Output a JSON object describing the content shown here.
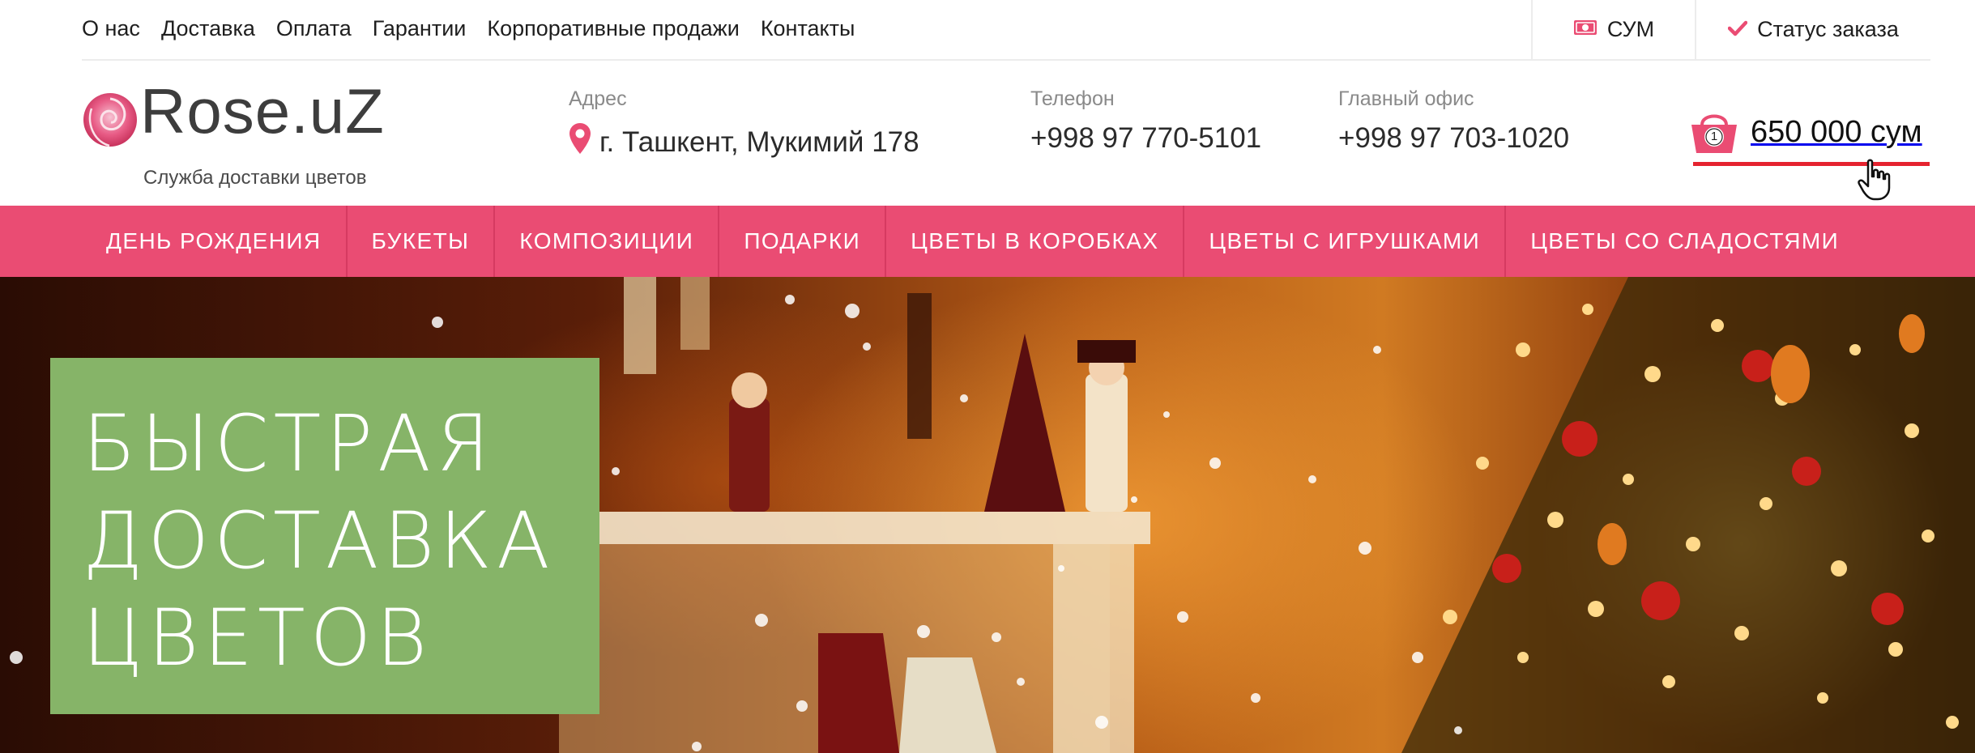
{
  "top_nav": {
    "links": [
      "О нас",
      "Доставка",
      "Оплата",
      "Гарантии",
      "Корпоративные продажи",
      "Контакты"
    ]
  },
  "currency": {
    "label": "СУМ",
    "icon": "money-icon"
  },
  "order_status": {
    "label": "Статус заказа",
    "icon": "check-icon"
  },
  "logo": {
    "title": "Rose.uZ",
    "subtitle": "Служба доставки цветов"
  },
  "address": {
    "label": "Адрес",
    "value": "г. Ташкент, Мукимий 178",
    "icon": "map-pin-icon"
  },
  "phone": {
    "label": "Телефон",
    "value": "+998 97 770-5101"
  },
  "office": {
    "label": "Главный офис",
    "value": "+998 97 703-1020"
  },
  "cart": {
    "count": "1",
    "total": "650 000 сум",
    "icon": "shopping-basket-icon"
  },
  "categories": [
    "ДЕНЬ РОЖДЕНИЯ",
    "БУКЕТЫ",
    "КОМПОЗИЦИИ",
    "ПОДАРКИ",
    "ЦВЕТЫ В КОРОБКАХ",
    "ЦВЕТЫ С ИГРУШКАМИ",
    "ЦВЕТЫ СО СЛАДОСТЯМИ"
  ],
  "hero": {
    "headline": "БЫСТРАЯ\nДОСТАВКА\nЦВЕТОВ"
  },
  "colors": {
    "brand_pink": "#ea4c73",
    "promo_green": "#86b468",
    "cart_red": "#e5232f"
  }
}
